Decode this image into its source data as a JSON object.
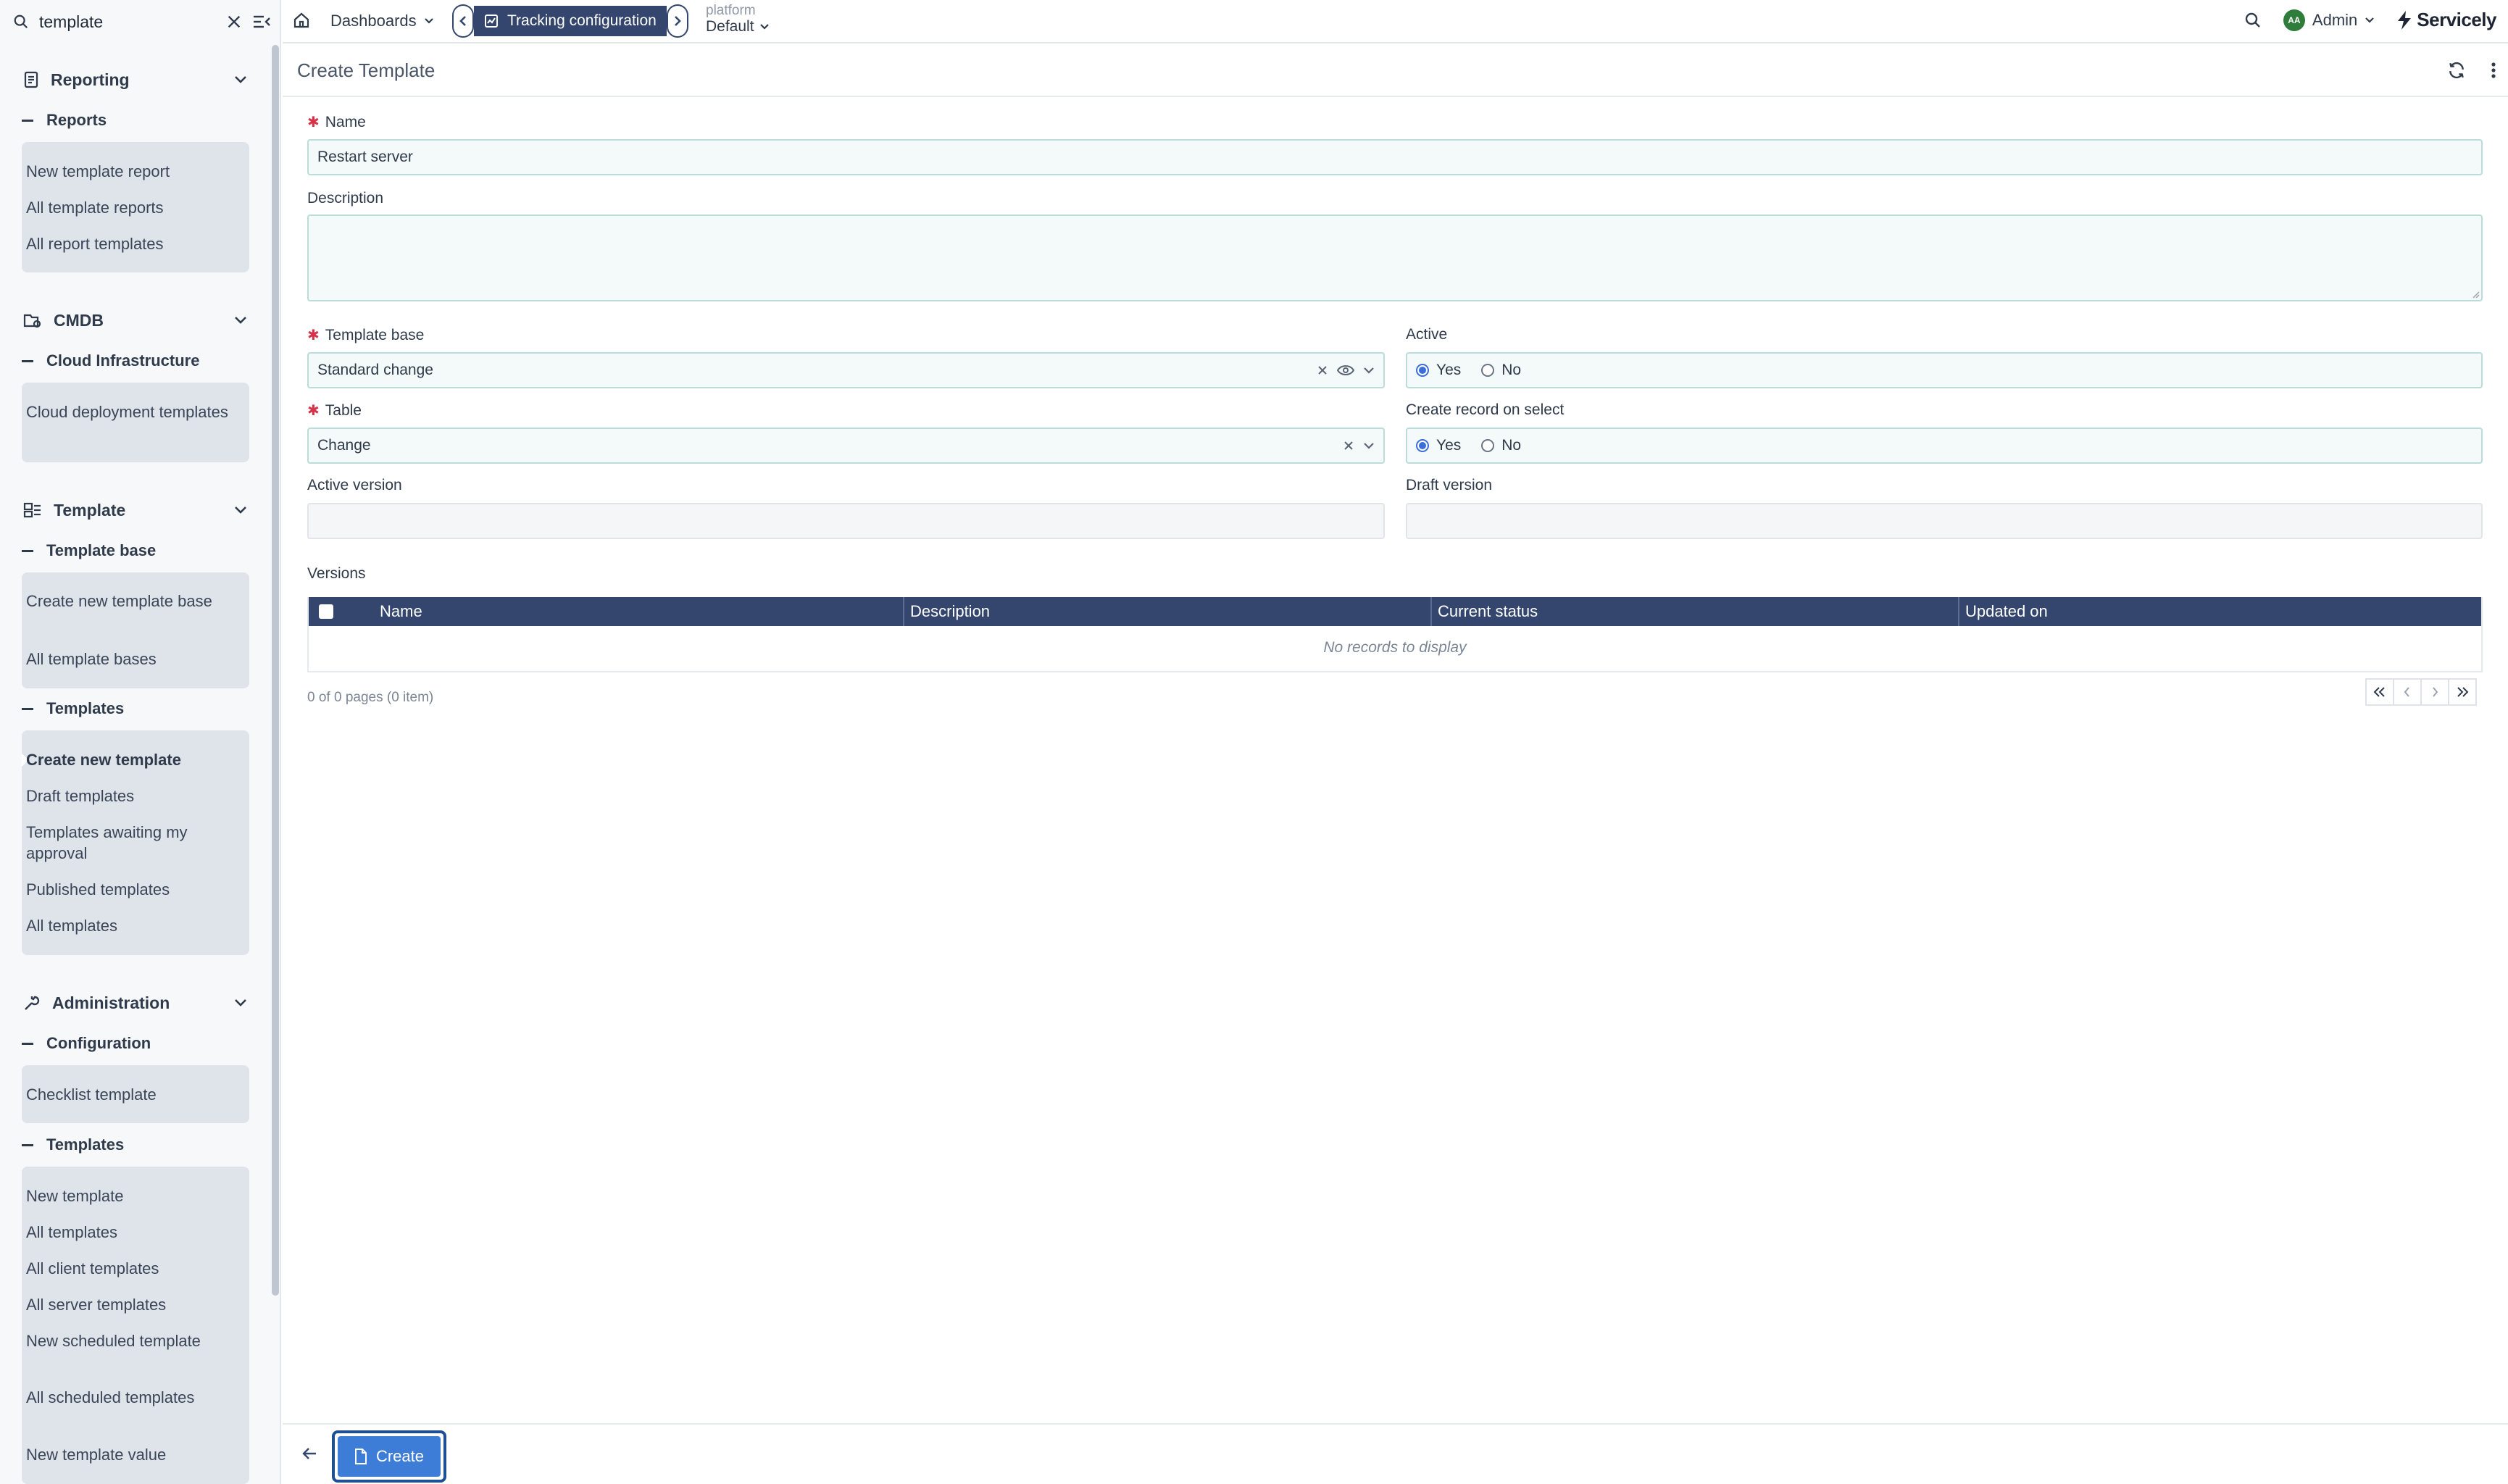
{
  "search": {
    "value": "template"
  },
  "sidebar": {
    "groups": [
      {
        "title": "Reporting",
        "sections": [
          {
            "title": "Reports",
            "items": [
              "New template report",
              "All template reports",
              "All report templates"
            ]
          }
        ]
      },
      {
        "title": "CMDB",
        "sections": [
          {
            "title": "Cloud Infrastructure",
            "items": [
              "Cloud deployment templates"
            ]
          }
        ]
      },
      {
        "title": "Template",
        "sections": [
          {
            "title": "Template base",
            "items": [
              "Create new template base",
              "All template bases"
            ]
          },
          {
            "title": "Templates",
            "items": [
              "Create new template",
              "Draft templates",
              "Templates awaiting my approval",
              "Published templates",
              "All templates"
            ]
          }
        ]
      },
      {
        "title": "Administration",
        "sections": [
          {
            "title": "Configuration",
            "items": [
              "Checklist template"
            ]
          },
          {
            "title": "Templates",
            "items": [
              "New template",
              "All templates",
              "All client templates",
              "All server templates",
              "New scheduled template",
              "All scheduled templates",
              "New template value"
            ]
          }
        ]
      }
    ]
  },
  "topbar": {
    "dashboards": "Dashboards",
    "active_tab": "Tracking configuration",
    "platform_label": "platform",
    "platform_value": "Default",
    "user": "Admin",
    "user_initials": "AA",
    "brand": "Servicely"
  },
  "form": {
    "title": "Create Template",
    "name_label": "Name",
    "name_value": "Restart server",
    "description_label": "Description",
    "description_value": "",
    "template_base_label": "Template base",
    "template_base_value": "Standard change",
    "active_label": "Active",
    "table_label": "Table",
    "table_value": "Change",
    "create_record_label": "Create record on select",
    "yes": "Yes",
    "no": "No",
    "active_version_label": "Active version",
    "draft_version_label": "Draft version"
  },
  "versions": {
    "label": "Versions",
    "columns": [
      "Name",
      "Description",
      "Current status",
      "Updated on"
    ],
    "empty": "No records to display",
    "pager_info": "0 of 0 pages (0 item)"
  },
  "footer": {
    "create": "Create"
  },
  "colors": {
    "header_navy": "#34466e",
    "primary_blue": "#3d7dd8",
    "required_red": "#d6334a"
  }
}
